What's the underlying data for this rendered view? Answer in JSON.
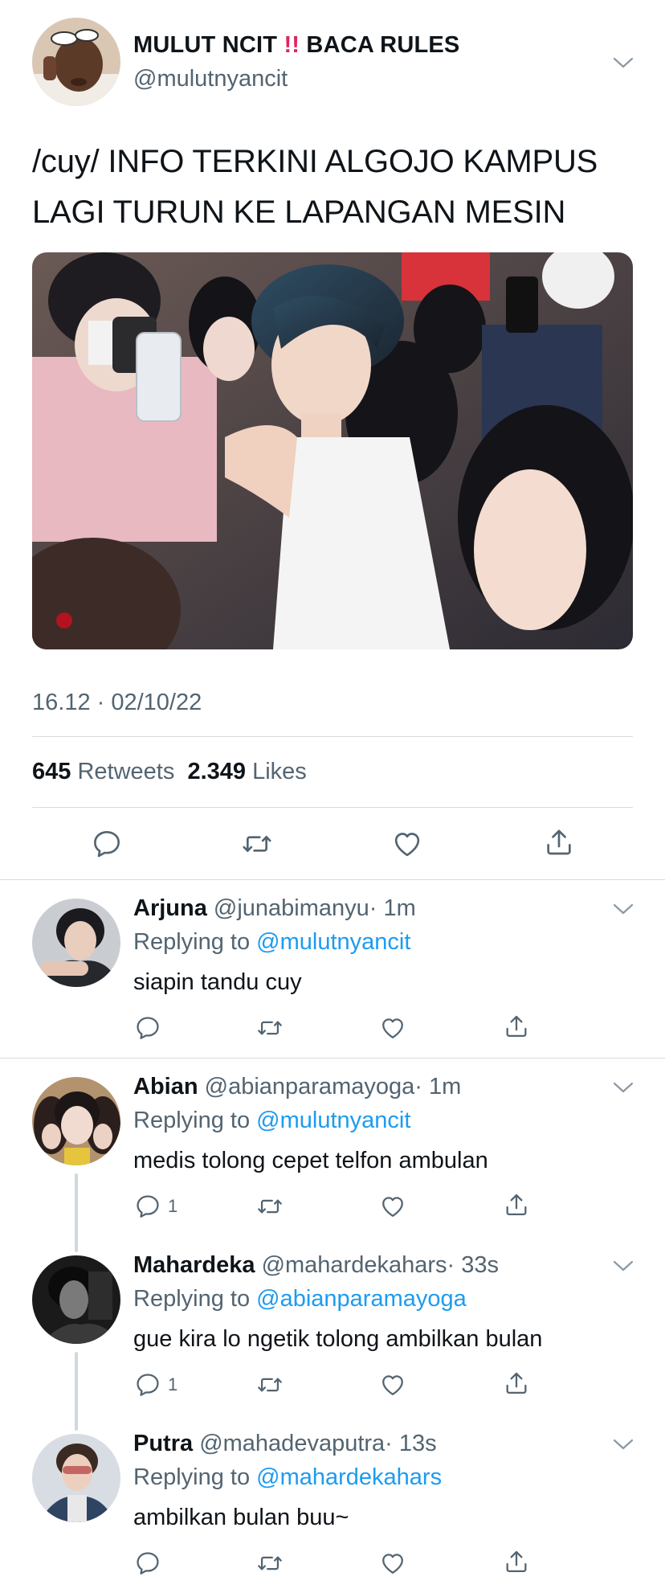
{
  "main_tweet": {
    "display_name_part1": "MULUT NCIT",
    "display_name_emoji": "‼️",
    "display_name_part2": "BACA RULES",
    "handle": "@mulutnyancit",
    "text_line1": "/cuy/ INFO TERKINI ALGOJO KAMPUS",
    "text_line2": "LAGI TURUN KE LAPANGAN MESIN",
    "timestamp": "16.12 · 02/10/22",
    "retweets_count": "645",
    "retweets_label": "Retweets",
    "likes_count": "2.349",
    "likes_label": "Likes"
  },
  "replies": [
    {
      "name": "Arjuna",
      "handle": "@junabimanyu",
      "time": "· 1m",
      "replying_prefix": "Replying to",
      "replying_to": "@mulutnyancit",
      "text": "siapin tandu cuy",
      "reply_count": ""
    },
    {
      "name": "Abian",
      "handle": "@abianparamayoga",
      "time": "· 1m",
      "replying_prefix": "Replying to",
      "replying_to": "@mulutnyancit",
      "text": "medis tolong cepet telfon ambulan",
      "reply_count": "1"
    },
    {
      "name": "Mahardeka",
      "handle": "@mahardekahars",
      "time": "· 33s",
      "replying_prefix": "Replying to",
      "replying_to": "@abianparamayoga",
      "text": "gue kira lo ngetik tolong ambilkan bulan",
      "reply_count": "1"
    },
    {
      "name": "Putra",
      "handle": "@mahadevaputra",
      "time": "· 13s",
      "replying_prefix": "Replying to",
      "replying_to": "@mahardekahars",
      "text": "ambilkan bulan buu~",
      "reply_count": ""
    }
  ],
  "icons": [
    "reply-icon",
    "retweet-icon",
    "like-icon",
    "share-icon",
    "chevron-down-icon"
  ],
  "colors": {
    "link": "#1d9bf0",
    "secondary": "#536471",
    "divider": "#d7dbdf",
    "alert": "#e0245e"
  }
}
